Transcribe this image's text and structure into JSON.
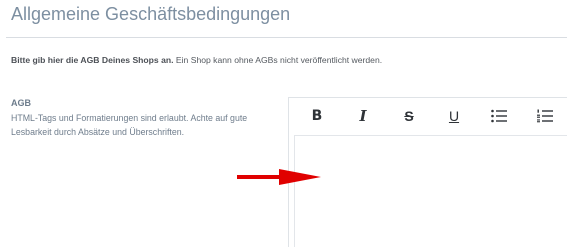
{
  "header": {
    "title": "Allgemeine Geschäftsbedingungen"
  },
  "notice": {
    "bold_text": "Bitte gib hier die AGB Deines Shops an.",
    "text": " Ein Shop kann ohne AGBs nicht veröffentlicht werden."
  },
  "field": {
    "label": "AGB",
    "help": "HTML-Tags und Formatierungen sind erlaubt. Achte auf gute Lesbarkeit durch Absätze und Überschriften."
  },
  "toolbar": {
    "bold": "B",
    "italic": "I",
    "strike": "S",
    "underline": "U",
    "icons": [
      "bold-icon",
      "italic-icon",
      "strikethrough-icon",
      "underline-icon",
      "bullet-list-icon",
      "numbered-list-icon"
    ]
  },
  "editor": {
    "value": ""
  },
  "colors": {
    "title": "#7d8fa1",
    "arrow": "#e00000",
    "border": "#dfe3e7"
  }
}
